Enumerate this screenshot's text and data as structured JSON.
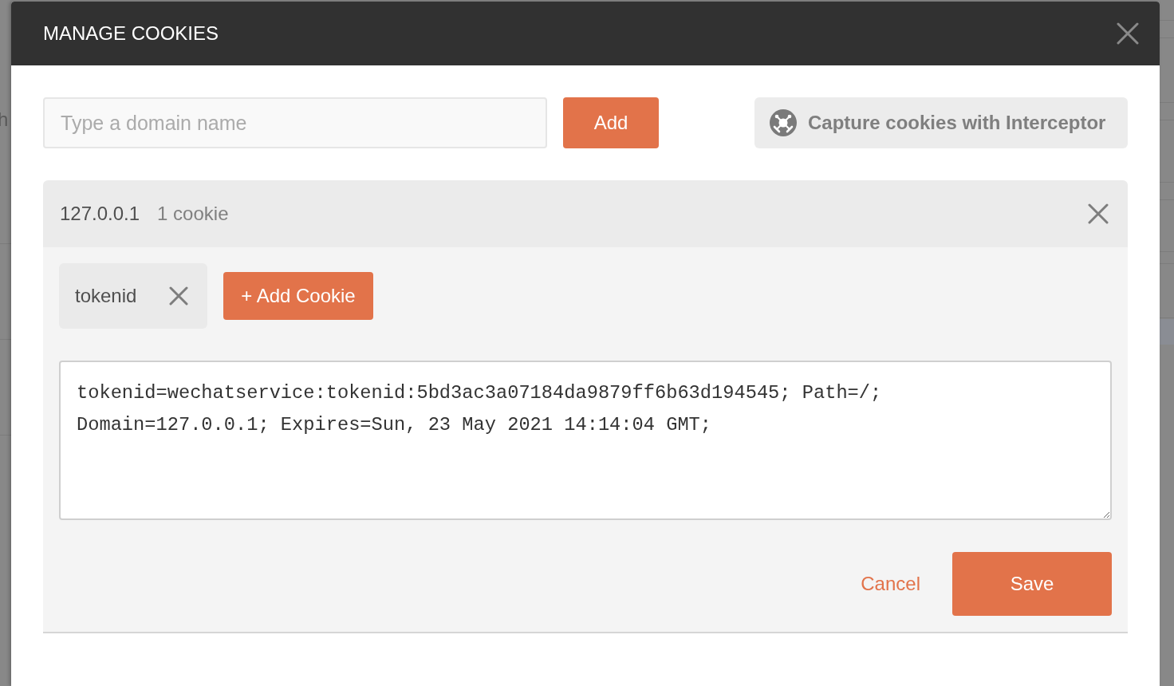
{
  "background": {
    "texts": [
      "h"
    ]
  },
  "dialog": {
    "title": "MANAGE COOKIES"
  },
  "domain_form": {
    "placeholder": "Type a domain name",
    "add_button": "Add",
    "capture_button": "Capture cookies with Interceptor"
  },
  "domains": [
    {
      "domain": "127.0.0.1",
      "count": "1 cookie",
      "cookies": [
        {
          "name": "tokenid"
        }
      ],
      "add_cookie_button": "+ Add Cookie",
      "editor": {
        "value": "tokenid=wechatservice:tokenid:5bd3ac3a07184da9879ff6b63d194545; Path=/; Domain=127.0.0.1; Expires=Sun, 23 May 2021 14:14:04 GMT;"
      },
      "actions": [
        {
          "label": "Cancel",
          "kind": "link"
        },
        {
          "label": "Save",
          "kind": "primary"
        }
      ]
    }
  ]
}
